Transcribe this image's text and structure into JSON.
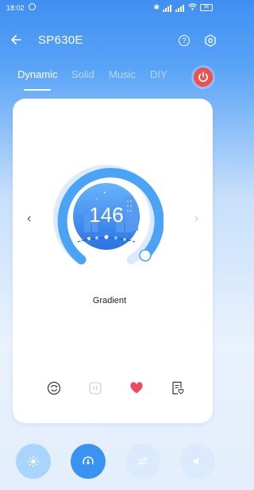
{
  "status": {
    "time": "18:02",
    "battery": "88"
  },
  "header": {
    "title": "SP630E",
    "back_icon": "arrow-left-icon",
    "help_icon": "help-icon",
    "settings_icon": "hexagon-gear-icon"
  },
  "tabs": [
    {
      "label": "Dynamic",
      "active": true
    },
    {
      "label": "Solid",
      "active": false
    },
    {
      "label": "Music",
      "active": false
    },
    {
      "label": "DIY",
      "active": false
    }
  ],
  "power": {
    "icon": "power-icon",
    "color": "#ef4f4f"
  },
  "dial": {
    "value": "146",
    "mode_label": "Gradient",
    "prev_symbol": "‹",
    "next_symbol": "›",
    "accent": "#4aa3f5"
  },
  "actions": [
    {
      "name": "loop-icon"
    },
    {
      "name": "pause-icon"
    },
    {
      "name": "heart-icon"
    },
    {
      "name": "playlist-edit-icon"
    }
  ],
  "bottom_bar": [
    {
      "name": "brightness-icon",
      "active": false
    },
    {
      "name": "speed-icon",
      "active": true
    },
    {
      "name": "sync-icon",
      "active": false
    },
    {
      "name": "volume-icon",
      "active": false
    }
  ]
}
